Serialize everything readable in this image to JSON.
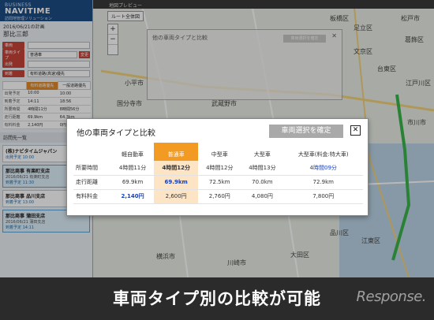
{
  "sidebar": {
    "brand_line1": "BUSINESS",
    "brand_line2": "NAVITIME",
    "brand_line3": "訪問地管理ソリューション",
    "plan_date": "2016/06/21の計画",
    "plan_user": "那比三郎",
    "rows": [
      {
        "label": "車両",
        "value": ""
      },
      {
        "label": "車両タイプ",
        "value": "普通車",
        "button": "変更"
      },
      {
        "label": "出発",
        "value": ""
      },
      {
        "label": "到着",
        "value": "有料道路(高速)優先"
      }
    ],
    "table_headers": [
      "",
      "有料道路優先",
      "一般道路優先"
    ],
    "table_rows": [
      [
        "出発予定",
        "10:00",
        "10:00"
      ],
      [
        "到着予定",
        "14:11",
        "18:56"
      ],
      [
        "所要時間",
        "4時間11分",
        "8時間56分"
      ],
      [
        "走行距離",
        "69.9km",
        "64.3km"
      ],
      [
        "有料料金",
        "2,140円",
        "0円"
      ]
    ],
    "list_head": "訪問先一覧",
    "destinations": [
      {
        "name": "(株)ナビタイムジャパン",
        "addr": "",
        "time": "出発予定 10:00"
      },
      {
        "name": "那比商事 有楽町支店",
        "addr": "2016/06/21 有楽町支店",
        "time": "到着予定 11:30"
      },
      {
        "name": "那比商事 品川支店",
        "addr": "",
        "time": "到着予定 13:00"
      },
      {
        "name": "那比商事 蒲田支店",
        "addr": "2016/06/21 蒲田支店",
        "time": "到着予定 14:11"
      }
    ]
  },
  "map": {
    "topbar": "地図プレビュー",
    "route_btn": "ルート全体図",
    "zoom_in": "+",
    "zoom_out": "−",
    "labels": [
      "小平市",
      "国分寺市",
      "武蔵野市",
      "文京区",
      "台東区",
      "足立区",
      "葛飾区",
      "江戸川区",
      "江東区",
      "品川区",
      "大田区",
      "川崎市",
      "横浜市",
      "市川市",
      "松戸市",
      "板橋区"
    ]
  },
  "bg_dialog": {
    "title": "他の車両タイプと比較",
    "button": "車両選択を確定",
    "close": "✕"
  },
  "dialog": {
    "title": "他の車両タイプと比較",
    "confirm_button": "車両選択を確定",
    "close": "✕",
    "headers": [
      "",
      "軽自動車",
      "普通車",
      "中型車",
      "大型車",
      "大型車(料金:特大車)"
    ],
    "rows": [
      {
        "label": "所要時間",
        "cells": [
          "4時間11分",
          "4時間12分",
          "4時間12分",
          "4時間13分",
          "4時間09分"
        ]
      },
      {
        "label": "走行距離",
        "cells": [
          "69.9km",
          "69.9km",
          "72.5km",
          "70.0km",
          "72.9km"
        ]
      },
      {
        "label": "有料料金",
        "cells": [
          "2,140円",
          "2,600円",
          "2,760円",
          "4,080円",
          "7,800円"
        ]
      }
    ]
  },
  "caption": "車両タイプ別の比較が可能",
  "watermark": "Response.",
  "colors": {
    "brand_blue": "#1d4d86",
    "highlight_orange": "#f39a22",
    "highlight_cell": "#fde4c4",
    "cheapest_blue": "#1a3fb4",
    "sidebar_red": "#c8453a"
  }
}
